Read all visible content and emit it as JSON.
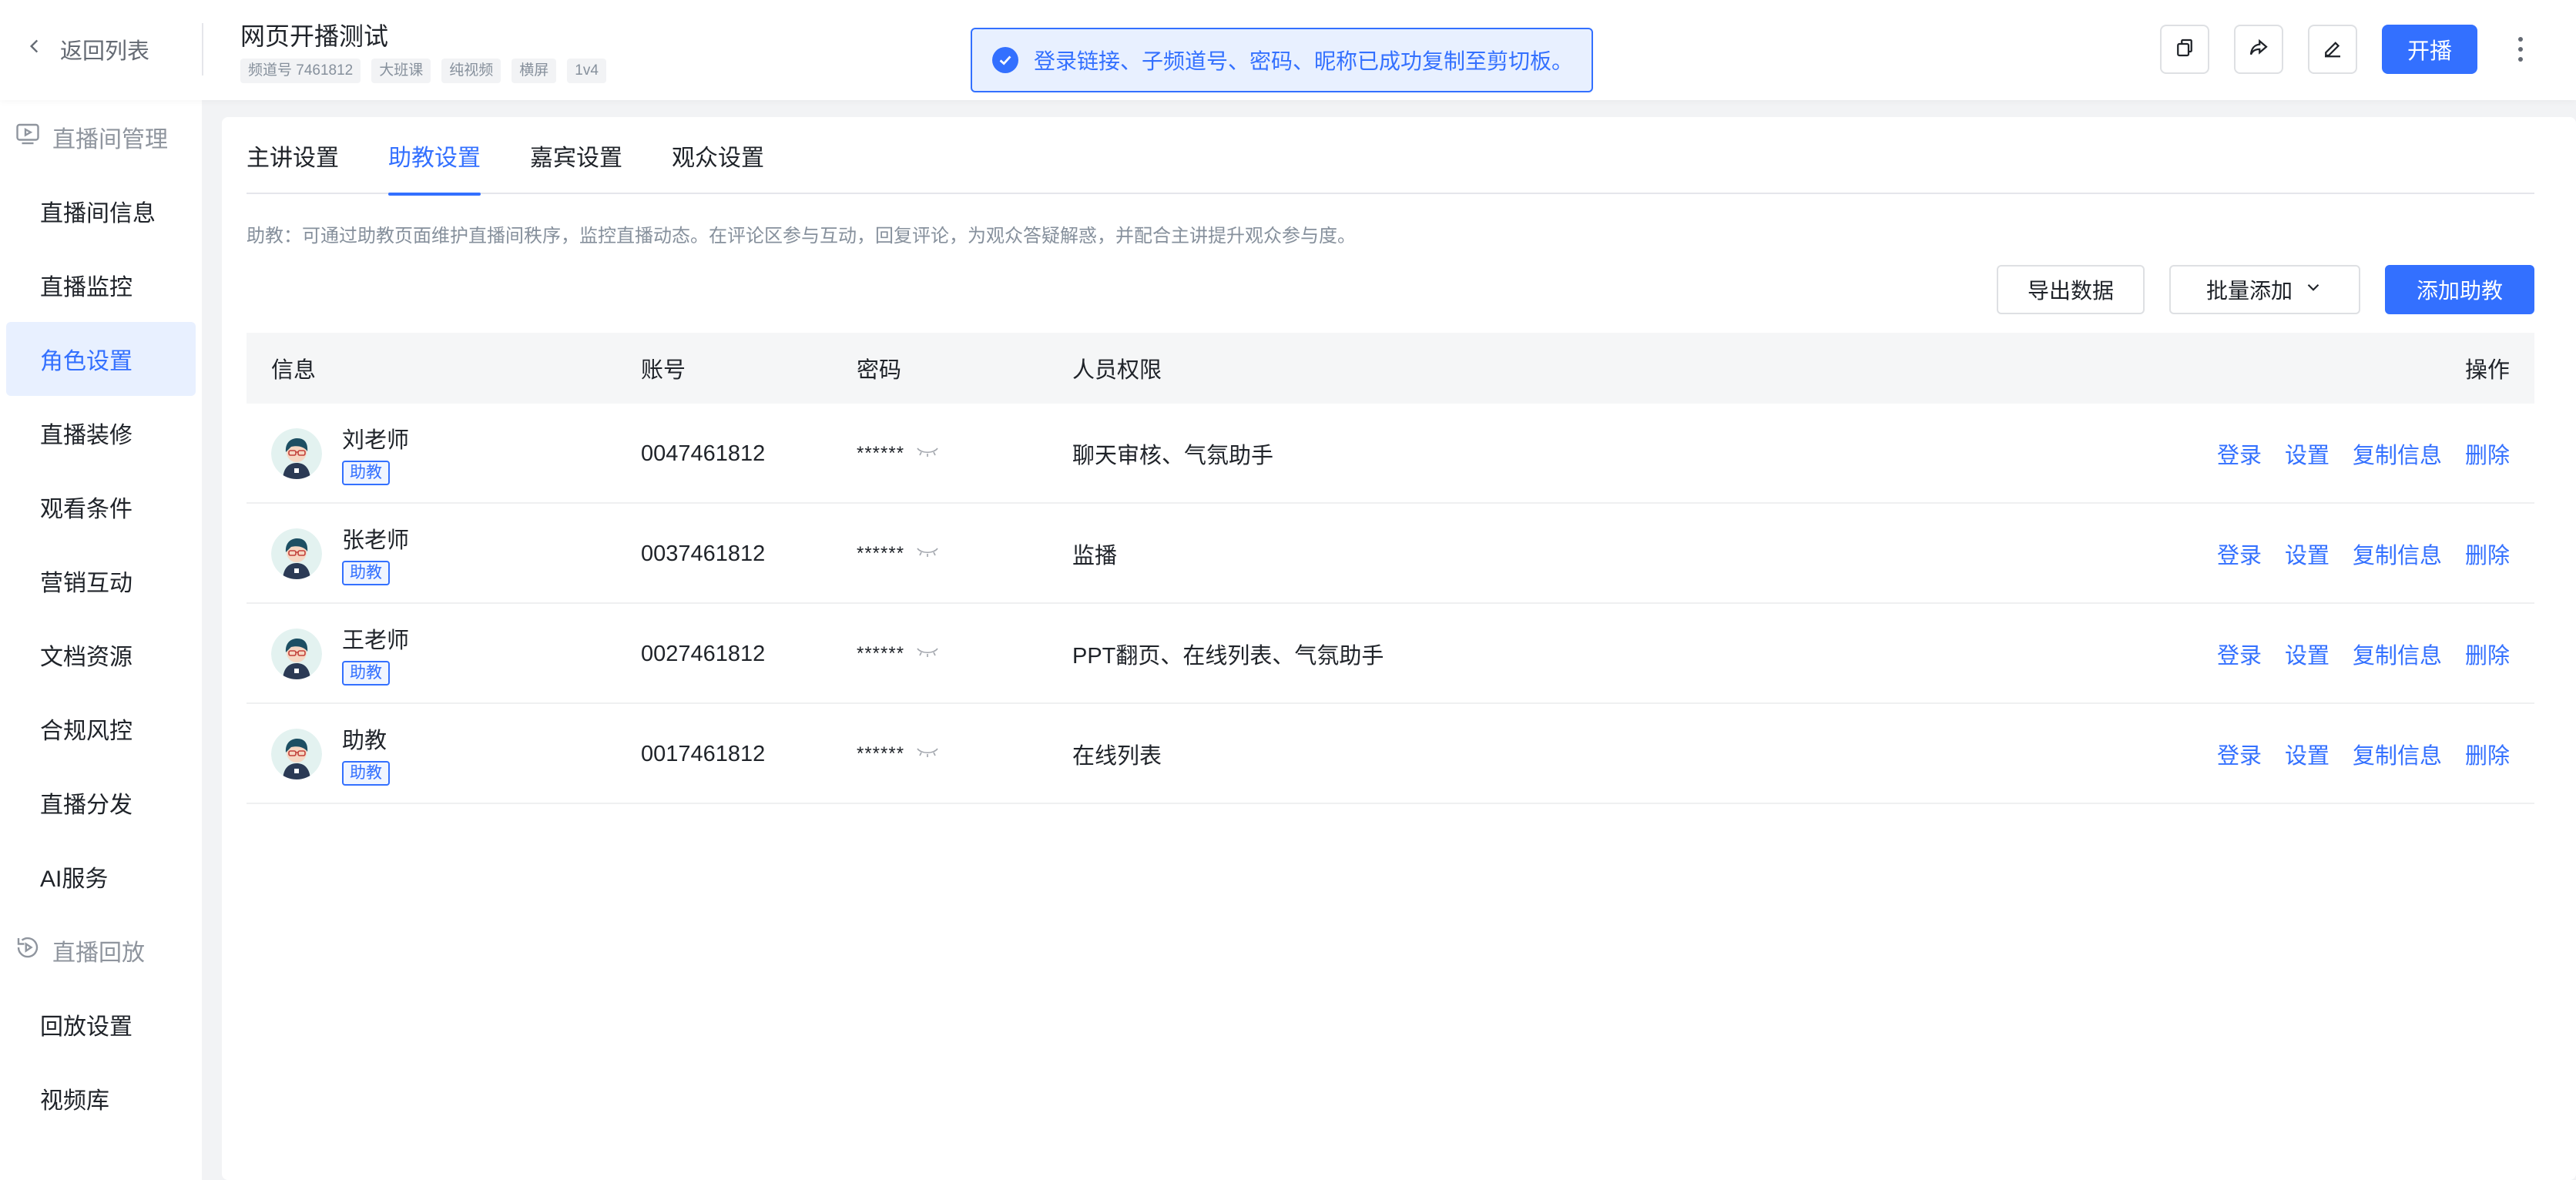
{
  "header": {
    "back_label": "返回列表",
    "title": "网页开播测试",
    "tags": [
      "频道号 7461812",
      "大班课",
      "纯视频",
      "横屏",
      "1v4"
    ],
    "toast": "登录链接、子频道号、密码、昵称已成功复制至剪切板。",
    "live_button": "开播"
  },
  "sidebar": {
    "group1": "直播间管理",
    "items": [
      "直播间信息",
      "直播监控",
      "角色设置",
      "直播装修",
      "观看条件",
      "营销互动",
      "文档资源",
      "合规风控",
      "直播分发",
      "AI服务"
    ],
    "active_index": 2,
    "group2": "直播回放",
    "items2": [
      "回放设置",
      "视频库"
    ]
  },
  "main": {
    "tabs": [
      "主讲设置",
      "助教设置",
      "嘉宾设置",
      "观众设置"
    ],
    "active_tab": 1,
    "description": "助教：可通过助教页面维护直播间秩序，监控直播动态。在评论区参与互动，回复评论，为观众答疑解惑，并配合主讲提升观众参与度。",
    "export_button": "导出数据",
    "batch_button": "批量添加",
    "add_button": "添加助教"
  },
  "table": {
    "columns": [
      "信息",
      "账号",
      "密码",
      "人员权限",
      "操作"
    ],
    "rows": [
      {
        "name": "刘老师",
        "role": "助教",
        "account": "0047461812",
        "password": "******",
        "permissions": "聊天审核、气氛助手"
      },
      {
        "name": "张老师",
        "role": "助教",
        "account": "0037461812",
        "password": "******",
        "permissions": "监播"
      },
      {
        "name": "王老师",
        "role": "助教",
        "account": "0027461812",
        "password": "******",
        "permissions": "PPT翻页、在线列表、气氛助手"
      },
      {
        "name": "助教",
        "role": "助教",
        "account": "0017461812",
        "password": "******",
        "permissions": "在线列表"
      }
    ],
    "actions": [
      "登录",
      "设置",
      "复制信息",
      "删除"
    ]
  },
  "colors": {
    "accent": "#3370ff",
    "toast_bg": "#e8f0ff",
    "sidebar_active_bg": "#e8f0ff"
  },
  "icons": {
    "back": "chevron-left-icon",
    "toast": "check-circle-icon",
    "copy": "copy-icon",
    "share": "share-icon",
    "edit": "edit-icon",
    "more": "more-vertical-icon",
    "group1": "live-room-icon",
    "group2": "replay-icon",
    "password_toggle": "eye-closed-icon",
    "dropdown": "chevron-down-icon"
  }
}
